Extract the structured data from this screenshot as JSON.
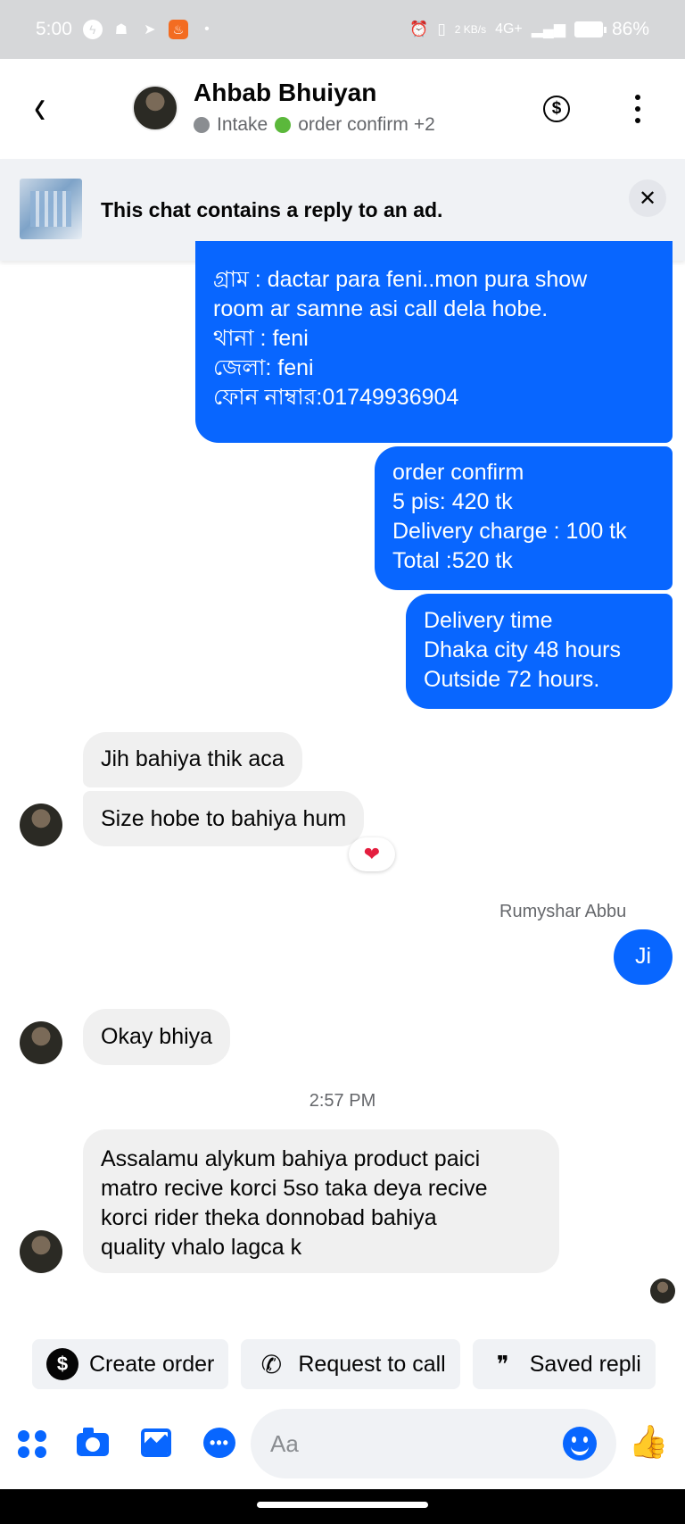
{
  "status_bar": {
    "time": "5:00",
    "network_speed": "2 KB/s",
    "network_type": "4G+",
    "battery": "86%"
  },
  "header": {
    "contact_name": "Ahbab Bhuiyan",
    "tag_1": "Intake",
    "tag_2": "order confirm",
    "more_tags": "+2",
    "tag_colors": {
      "intake": "#8a8d91",
      "order_confirm": "#5bb83b"
    }
  },
  "ad_banner": {
    "text": "This chat contains a reply to an ad."
  },
  "messages": [
    {
      "direction": "outgoing",
      "lines": [
        "গ্রাম   : dactar para feni..mon pura show",
        "room ar samne asi call dela hobe.",
        "থানা  : feni",
        "জেলা: feni",
        "ফোন নাম্বার:01749936904"
      ]
    },
    {
      "direction": "outgoing",
      "lines": [
        "order confirm",
        "5 pis: 420 tk",
        "Delivery charge : 100 tk",
        "Total :520 tk"
      ]
    },
    {
      "direction": "outgoing",
      "lines": [
        "Delivery time",
        "Dhaka city 48 hours",
        "Outside 72 hours."
      ]
    },
    {
      "direction": "incoming",
      "text": "Jih bahiya thik aca"
    },
    {
      "direction": "incoming",
      "text": "Size hobe to bahiya hum",
      "reaction": "❤"
    },
    {
      "direction": "outgoing",
      "sender": "Rumyshar Abbu",
      "text": "Ji"
    },
    {
      "direction": "incoming",
      "text": "Okay bhiya"
    },
    {
      "direction": "incoming",
      "timestamp": "2:57 PM",
      "lines": [
        "Assalamu alykum bahiya product paici",
        "matro recive korci 5so taka deya recive",
        "korci rider theka donnobad bahiya",
        "quality vhalo lagca k"
      ]
    }
  ],
  "quick_actions": [
    {
      "label": "Create order",
      "icon": "dollar-circle-icon"
    },
    {
      "label": "Request to call",
      "icon": "phone-plus-icon"
    },
    {
      "label": "Saved repli",
      "icon": "chat-bubbles-icon"
    }
  ],
  "composer": {
    "placeholder": "Aa"
  },
  "colors": {
    "accent": "#0866ff",
    "incoming_bubble": "#f0f0f0",
    "status_bar": "#d6d7d9"
  }
}
